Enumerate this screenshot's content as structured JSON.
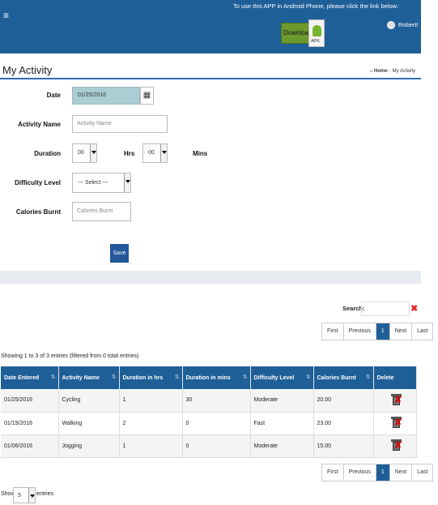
{
  "header": {
    "menu_glyph": "≡",
    "notice": "To use this APP in Android Phone, please click the link below:",
    "download_label": "Download",
    "apk_label": "APK",
    "user_name": "Robert!"
  },
  "page": {
    "title": "My Activity",
    "breadcrumb_home": "Home",
    "breadcrumb_sep": "›",
    "breadcrumb_current": "My Activity"
  },
  "form": {
    "date_label": "Date",
    "date_value": "01/25/2016",
    "activity_label": "Activity Name",
    "activity_placeholder": "Activity Name",
    "duration_label": "Duration",
    "hrs_value": "00",
    "hrs_label": "Hrs",
    "mins_value": "00",
    "mins_label": "Mins",
    "difficulty_label": "Difficulty Level",
    "difficulty_value": "--- Select ---",
    "calories_label": "Calories Burnt",
    "calories_placeholder": "Calories Burnt",
    "save_label": "Save"
  },
  "table_tools": {
    "search_label": "Search:",
    "clear_glyph": "✖",
    "info": "Showing 1 to 3 of 3 entries (filtered from 0 total entries)",
    "pager": {
      "first": "First",
      "previous": "Previous",
      "current": "1",
      "next": "Next",
      "last": "Last"
    },
    "show_label": "Show",
    "show_value": "5",
    "entries_label": "entries"
  },
  "table": {
    "headers": [
      "Date Entered",
      "Activity Name",
      "Duration in hrs",
      "Duration in mins",
      "Difficulty Level",
      "Calories Burnt",
      "Delete"
    ],
    "sort_glyph": "⇅",
    "rows": [
      [
        "01/25/2016",
        "Cycling",
        "1",
        "30",
        "Moderate",
        "20.00"
      ],
      [
        "01/19/2016",
        "Walking",
        "2",
        "0",
        "Fast",
        "23.00"
      ],
      [
        "01/06/2016",
        "Jogging",
        "1",
        "0",
        "Moderate",
        "15.00"
      ]
    ],
    "delete_glyph": "✘"
  },
  "colors": {
    "primary": "#1f5f97",
    "date_bg": "#a9cdd2",
    "danger": "#e12d2d"
  }
}
